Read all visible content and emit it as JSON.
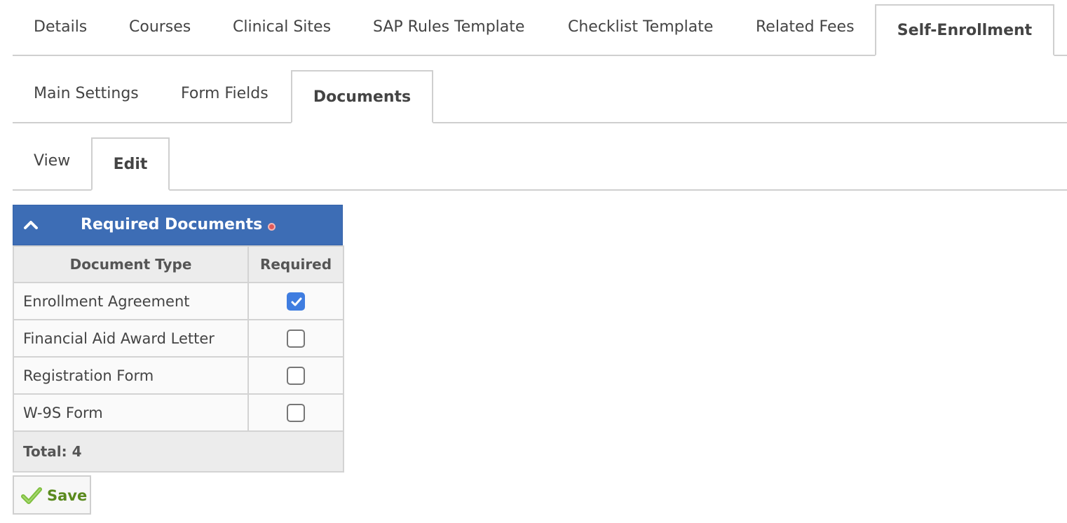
{
  "tabs_primary": {
    "items": [
      {
        "label": "Details"
      },
      {
        "label": "Courses"
      },
      {
        "label": "Clinical Sites"
      },
      {
        "label": "SAP Rules Template"
      },
      {
        "label": "Checklist Template"
      },
      {
        "label": "Related Fees"
      },
      {
        "label": "Self-Enrollment",
        "active": true
      }
    ]
  },
  "tabs_secondary": {
    "items": [
      {
        "label": "Main Settings"
      },
      {
        "label": "Form Fields"
      },
      {
        "label": "Documents",
        "active": true
      }
    ]
  },
  "tabs_mode": {
    "items": [
      {
        "label": "View"
      },
      {
        "label": "Edit",
        "active": true
      }
    ]
  },
  "panel": {
    "title": "Required Documents",
    "collapse_icon": "chevron-up-icon",
    "indicator_icon": "required-indicator-icon",
    "header_color": "#3d6db5"
  },
  "table": {
    "columns": [
      "Document Type",
      "Required"
    ],
    "rows": [
      {
        "type": "Enrollment Agreement",
        "required": true
      },
      {
        "type": "Financial Aid Award Letter",
        "required": false
      },
      {
        "type": "Registration Form",
        "required": false
      },
      {
        "type": "W-9S Form",
        "required": false
      }
    ],
    "total_label": "Total: 4"
  },
  "actions": {
    "save_label": "Save",
    "save_icon": "checkmark-icon"
  },
  "colors": {
    "accent": "#3d6db5",
    "checkbox_checked": "#3f7de0",
    "save_text": "#5a8a1e"
  }
}
